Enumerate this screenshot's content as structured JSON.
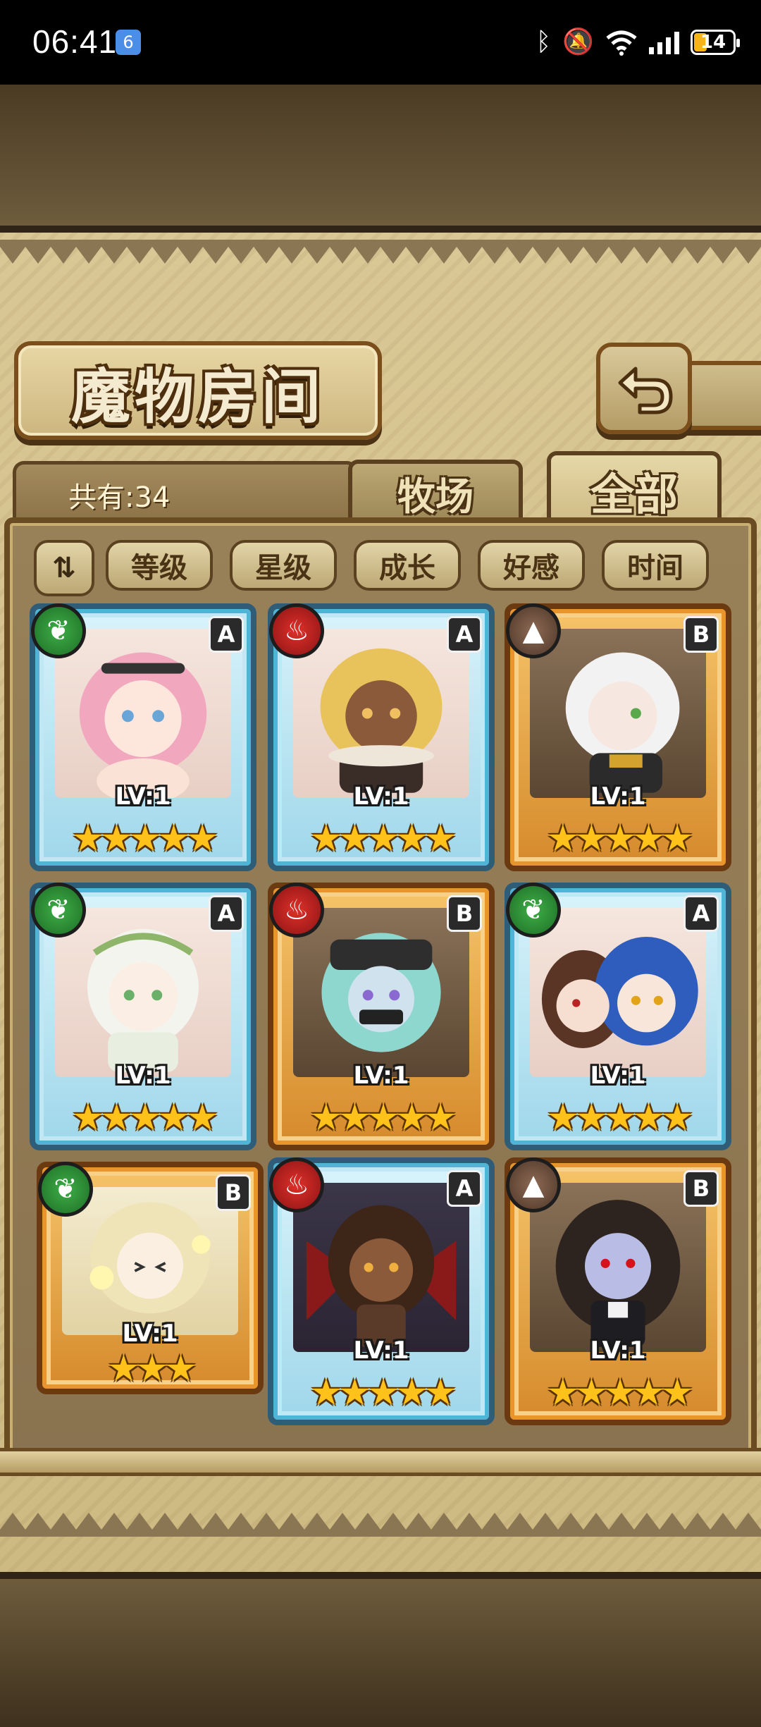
{
  "status_bar": {
    "time": "06:41",
    "app_badge": "6",
    "battery_level": "14",
    "icons": [
      "bluetooth-icon",
      "mute-icon",
      "wifi-6-icon",
      "signal-icon",
      "battery-icon"
    ]
  },
  "header": {
    "title": "魔物房间",
    "back_icon": "return-arrow-icon"
  },
  "tabs": {
    "count_label": "共有:34",
    "items": [
      {
        "label": "牧场",
        "selected": false
      },
      {
        "label": "全部",
        "selected": true
      }
    ]
  },
  "sort": {
    "toggle_icon": "sort-order-icon",
    "toggle_symbol": "⇅",
    "buttons": [
      "等级",
      "星级",
      "成长",
      "好感",
      "时间"
    ]
  },
  "cards": [
    {
      "element": "leaf",
      "rank": "A",
      "level": "LV:1",
      "stars": "★★★★★",
      "frame": "blue"
    },
    {
      "element": "fire",
      "rank": "A",
      "level": "LV:1",
      "stars": "★★★★★",
      "frame": "blue"
    },
    {
      "element": "mountain",
      "rank": "B",
      "level": "LV:1",
      "stars": "★★★★★",
      "frame": "orange"
    },
    {
      "element": "leaf",
      "rank": "A",
      "level": "LV:1",
      "stars": "★★★★★",
      "frame": "blue"
    },
    {
      "element": "fire",
      "rank": "B",
      "level": "LV:1",
      "stars": "★★★★★",
      "frame": "orange"
    },
    {
      "element": "leaf",
      "rank": "A",
      "level": "LV:1",
      "stars": "★★★★★",
      "frame": "blue"
    },
    {
      "element": "leaf",
      "rank": "B",
      "level": "LV:1",
      "stars": "★★★",
      "frame": "orange"
    },
    {
      "element": "fire",
      "rank": "A",
      "level": "LV:1",
      "stars": "★★★★★",
      "frame": "blue"
    },
    {
      "element": "mountain",
      "rank": "B",
      "level": "LV:1",
      "stars": "★★★★★",
      "frame": "orange"
    }
  ],
  "colors": {
    "parchment": "#d9c795",
    "frame_brown": "#6b4c22",
    "star_gold": "#ffc21a",
    "leaf_green": "#1d6e26",
    "fire_red": "#8a1414"
  }
}
